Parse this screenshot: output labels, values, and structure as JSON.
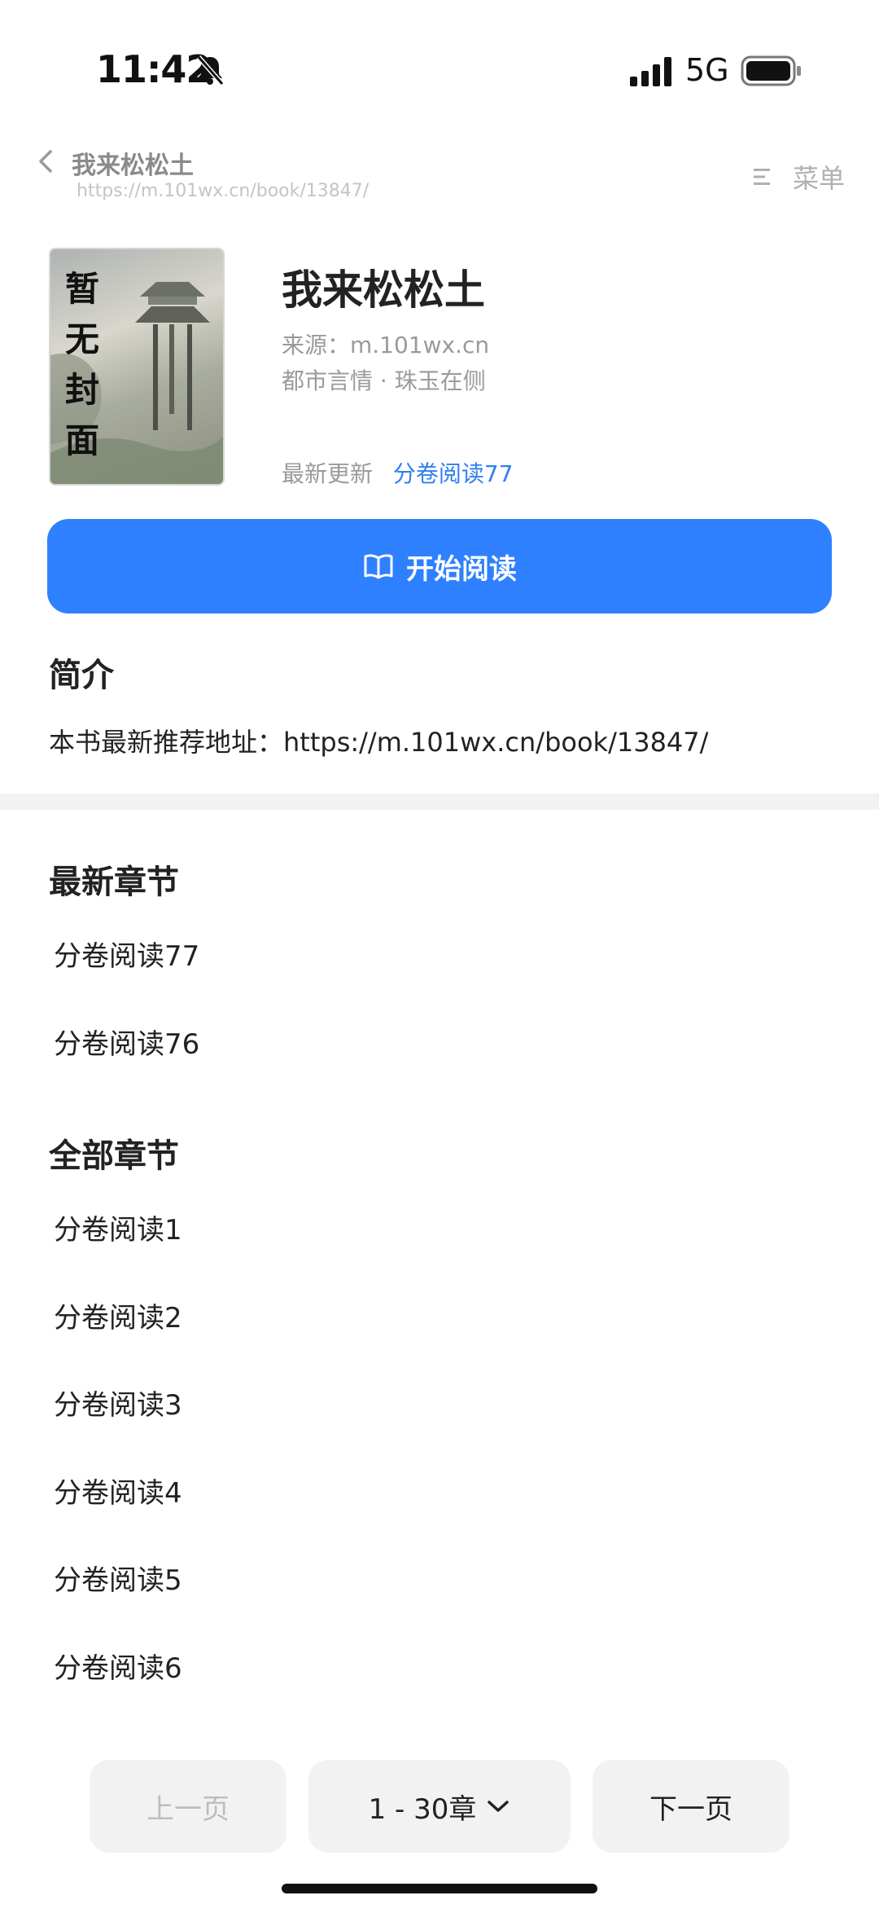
{
  "status": {
    "time": "11:42",
    "network": "5G"
  },
  "header": {
    "title": "我来松松土",
    "url": "https://m.101wx.cn/book/13847/",
    "menu_label": "菜单"
  },
  "book": {
    "cover_text": "暂无封面",
    "title": "我来松松土",
    "source": "来源：m.101wx.cn",
    "genre": "都市言情 · 珠玉在侧",
    "latest_label": "最新更新",
    "latest_chapter": "分卷阅读77"
  },
  "read_button": "开始阅读",
  "intro": {
    "heading": "简介",
    "text": "本书最新推荐地址：https://m.101wx.cn/book/13847/"
  },
  "latest_section": {
    "heading": "最新章节",
    "items": [
      "分卷阅读77",
      "分卷阅读76"
    ]
  },
  "all_section": {
    "heading": "全部章节",
    "items": [
      "分卷阅读1",
      "分卷阅读2",
      "分卷阅读3",
      "分卷阅读4",
      "分卷阅读5",
      "分卷阅读6"
    ]
  },
  "pager": {
    "prev": "上一页",
    "range": "1 - 30章",
    "next": "下一页"
  },
  "colors": {
    "accent": "#2f80ff",
    "link": "#2f7ff2"
  }
}
